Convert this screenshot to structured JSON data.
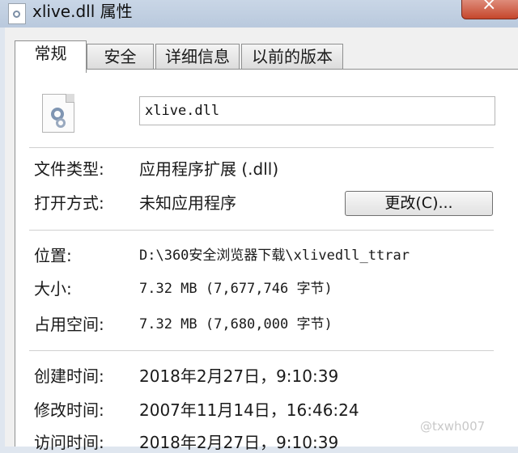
{
  "window": {
    "title": "xlive.dll 属性"
  },
  "tabs": [
    {
      "label": "常规"
    },
    {
      "label": "安全"
    },
    {
      "label": "详细信息"
    },
    {
      "label": "以前的版本"
    }
  ],
  "file": {
    "name": "xlive.dll"
  },
  "properties": {
    "type_label": "文件类型:",
    "type_value": "应用程序扩展 (.dll)",
    "open_with_label": "打开方式:",
    "open_with_value": "未知应用程序",
    "change_button": "更改(C)...",
    "location_label": "位置:",
    "location_value": "D:\\360安全浏览器下载\\xlivedll_ttrar",
    "size_label": "大小:",
    "size_value": "7.32 MB (7,677,746 字节)",
    "disk_size_label": "占用空间:",
    "disk_size_value": "7.32 MB (7,680,000 字节)",
    "created_label": "创建时间:",
    "created_value": "2018年2月27日，9:10:39",
    "modified_label": "修改时间:",
    "modified_value": "2007年11月14日，16:46:24",
    "accessed_label": "访问时间:",
    "accessed_value": "2018年2月27日，9:10:39"
  },
  "watermark": "@txwh007"
}
